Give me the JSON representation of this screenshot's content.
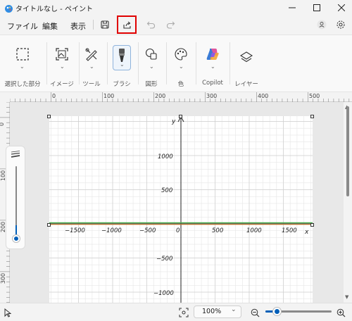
{
  "title_bar": {
    "title": "タイトルなし - ペイント"
  },
  "menu": {
    "file": "ファイル",
    "edit": "編集",
    "view": "表示"
  },
  "ribbon": {
    "groups": [
      {
        "label": "選択した部分",
        "icon": "selection-icon"
      },
      {
        "label": "イメージ",
        "icon": "image-icon"
      },
      {
        "label": "ツール",
        "icon": "tools-icon"
      },
      {
        "label": "ブラシ",
        "icon": "brush-icon"
      },
      {
        "label": "図形",
        "icon": "shapes-icon"
      },
      {
        "label": "色",
        "icon": "palette-icon"
      },
      {
        "label": "Copilot",
        "icon": "copilot-icon"
      },
      {
        "label": "レイヤー",
        "icon": "layers-icon"
      }
    ]
  },
  "ruler": {
    "h": [
      "0",
      "100",
      "200",
      "300",
      "400",
      "500"
    ],
    "v": [
      "0",
      "100",
      "200",
      "300"
    ]
  },
  "graph": {
    "x_label": "x",
    "y_label": "y",
    "x_ticks": [
      "−1500",
      "−1000",
      "−500",
      "0",
      "500",
      "1000",
      "1500"
    ],
    "y_ticks": [
      "1000",
      "500",
      "−500",
      "−1000"
    ]
  },
  "status": {
    "zoom": "100%"
  },
  "colors": {
    "accent": "#005fb8",
    "highlight": "#e00000",
    "line_green": "#4caf50",
    "line_orange": "#e08a3c"
  }
}
